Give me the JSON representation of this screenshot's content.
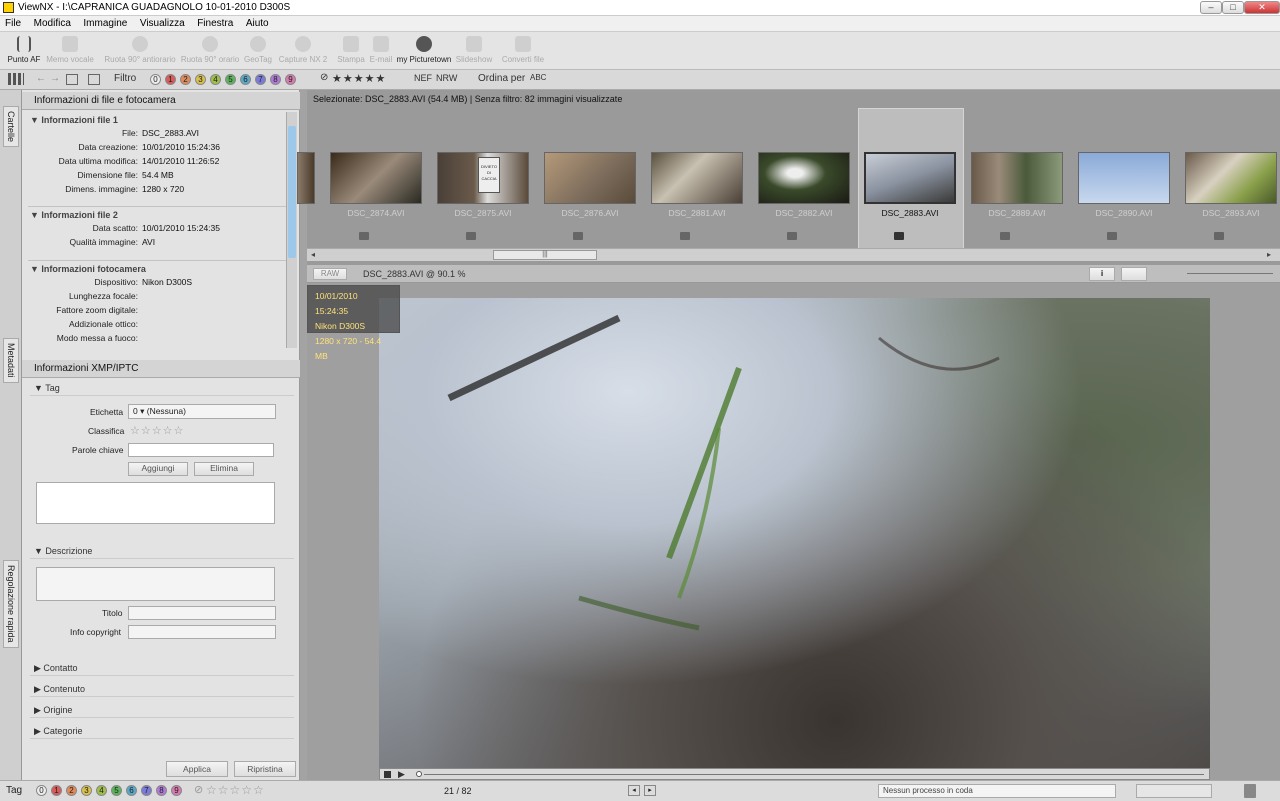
{
  "window": {
    "title": "ViewNX - I:\\CAPRANICA GUADAGNOLO 10-01-2010 D300S",
    "min": "–",
    "max": "□",
    "close": "✕"
  },
  "menu": [
    "File",
    "Modifica",
    "Immagine",
    "Visualizza",
    "Finestra",
    "Aiuto"
  ],
  "toolbar": [
    {
      "label": "Punto AF",
      "enabled": true
    },
    {
      "label": "Memo vocale",
      "enabled": false
    },
    {
      "label": "Ruota 90° antiorario",
      "enabled": false
    },
    {
      "label": "Ruota 90° orario",
      "enabled": false
    },
    {
      "label": "GeoTag",
      "enabled": false
    },
    {
      "label": "Capture NX 2",
      "enabled": false
    },
    {
      "label": "Stampa",
      "enabled": false
    },
    {
      "label": "E-mail",
      "enabled": false
    },
    {
      "label": "my Picturetown",
      "enabled": true
    },
    {
      "label": "Slideshow",
      "enabled": false
    },
    {
      "label": "Converti file",
      "enabled": false
    }
  ],
  "filterbar": {
    "filter_label": "Filtro",
    "numbers": [
      "0",
      "1",
      "2",
      "3",
      "4",
      "5",
      "6",
      "7",
      "8",
      "9"
    ],
    "stars": "★★★★★",
    "nef": "NEF",
    "nrw": "NRW",
    "sort_label": "Ordina per",
    "sort_icon": "ABC"
  },
  "left_tabs": {
    "folders": "Cartelle",
    "metadata": "Metadati",
    "quick_adjust": "Regolazione rapida"
  },
  "file_info": {
    "panel_title": "Informazioni di file e fotocamera",
    "section1_title": "Informazioni file 1",
    "section1": [
      {
        "k": "File:",
        "v": "DSC_2883.AVI"
      },
      {
        "k": "Data creazione:",
        "v": "10/01/2010 15:24:36"
      },
      {
        "k": "Data ultima modifica:",
        "v": "14/01/2010 11:26:52"
      },
      {
        "k": "Dimensione file:",
        "v": "54.4 MB"
      },
      {
        "k": "Dimens. immagine:",
        "v": "1280 x 720"
      }
    ],
    "section2_title": "Informazioni file 2",
    "section2": [
      {
        "k": "Data scatto:",
        "v": "10/01/2010 15:24:35"
      },
      {
        "k": "Qualità immagine:",
        "v": "AVI"
      }
    ],
    "section3_title": "Informazioni fotocamera",
    "section3": [
      {
        "k": "Dispositivo:",
        "v": "Nikon D300S"
      },
      {
        "k": "Lunghezza focale:",
        "v": ""
      },
      {
        "k": "Fattore zoom digitale:",
        "v": ""
      },
      {
        "k": "Addizionale ottico:",
        "v": ""
      },
      {
        "k": "Modo messa a fuoco:",
        "v": ""
      }
    ]
  },
  "xmp": {
    "panel_title": "Informazioni XMP/IPTC",
    "tag_title": "Tag",
    "label_key": "Etichetta",
    "label_num": "0",
    "label_val": "(Nessuna)",
    "rating_key": "Classifica",
    "rating_stars": "☆☆☆☆☆",
    "keywords_key": "Parole chiave",
    "add_btn": "Aggiungi",
    "delete_btn": "Elimina",
    "desc_title": "Descrizione",
    "title_key": "Titolo",
    "copyright_key": "Info copyright",
    "contact": "Contatto",
    "content": "Contenuto",
    "origin": "Origine",
    "categories": "Categorie",
    "apply_btn": "Applica",
    "reset_btn": "Ripristina"
  },
  "thumbs": {
    "selection_info": "Selezionate: DSC_2883.AVI (54.4 MB) | Senza filtro: 82 immagini visualizzate",
    "items": [
      "DSC_2874.AVI",
      "DSC_2875.AVI",
      "DSC_2876.AVI",
      "DSC_2881.AVI",
      "DSC_2882.AVI",
      "DSC_2883.AVI",
      "DSC_2889.AVI",
      "DSC_2890.AVI",
      "DSC_2893.AVI"
    ],
    "selected_index": 5,
    "scroll_grip": "|||",
    "sign_text": "DIVIETO DI CACCIA"
  },
  "viewer": {
    "raw_btn": "RAW",
    "caption": "DSC_2883.AVI @ 90.1 %",
    "overlay": [
      "10/01/2010 15:24:35",
      "Nikon D300S",
      "1280 x 720 - 54.4 MB"
    ],
    "info_btn": "i"
  },
  "statusbar": {
    "tag_label": "Tag",
    "numbers": [
      "0",
      "1",
      "2",
      "3",
      "4",
      "5",
      "6",
      "7",
      "8",
      "9"
    ],
    "stars": "☆☆☆☆☆",
    "page": "21 / 82",
    "process": "Nessun processo in coda"
  },
  "colors": {
    "selected_thumb_bg": "#bdbdbd",
    "overlay_text": "#ffe27a",
    "number_colors": [
      "#eeeeee",
      "#d85a5a",
      "#e08a5a",
      "#d9c04a",
      "#9ec04a",
      "#5ab55a",
      "#5aa8c8",
      "#7a7ad8",
      "#b07ad8",
      "#d87ab0"
    ]
  }
}
